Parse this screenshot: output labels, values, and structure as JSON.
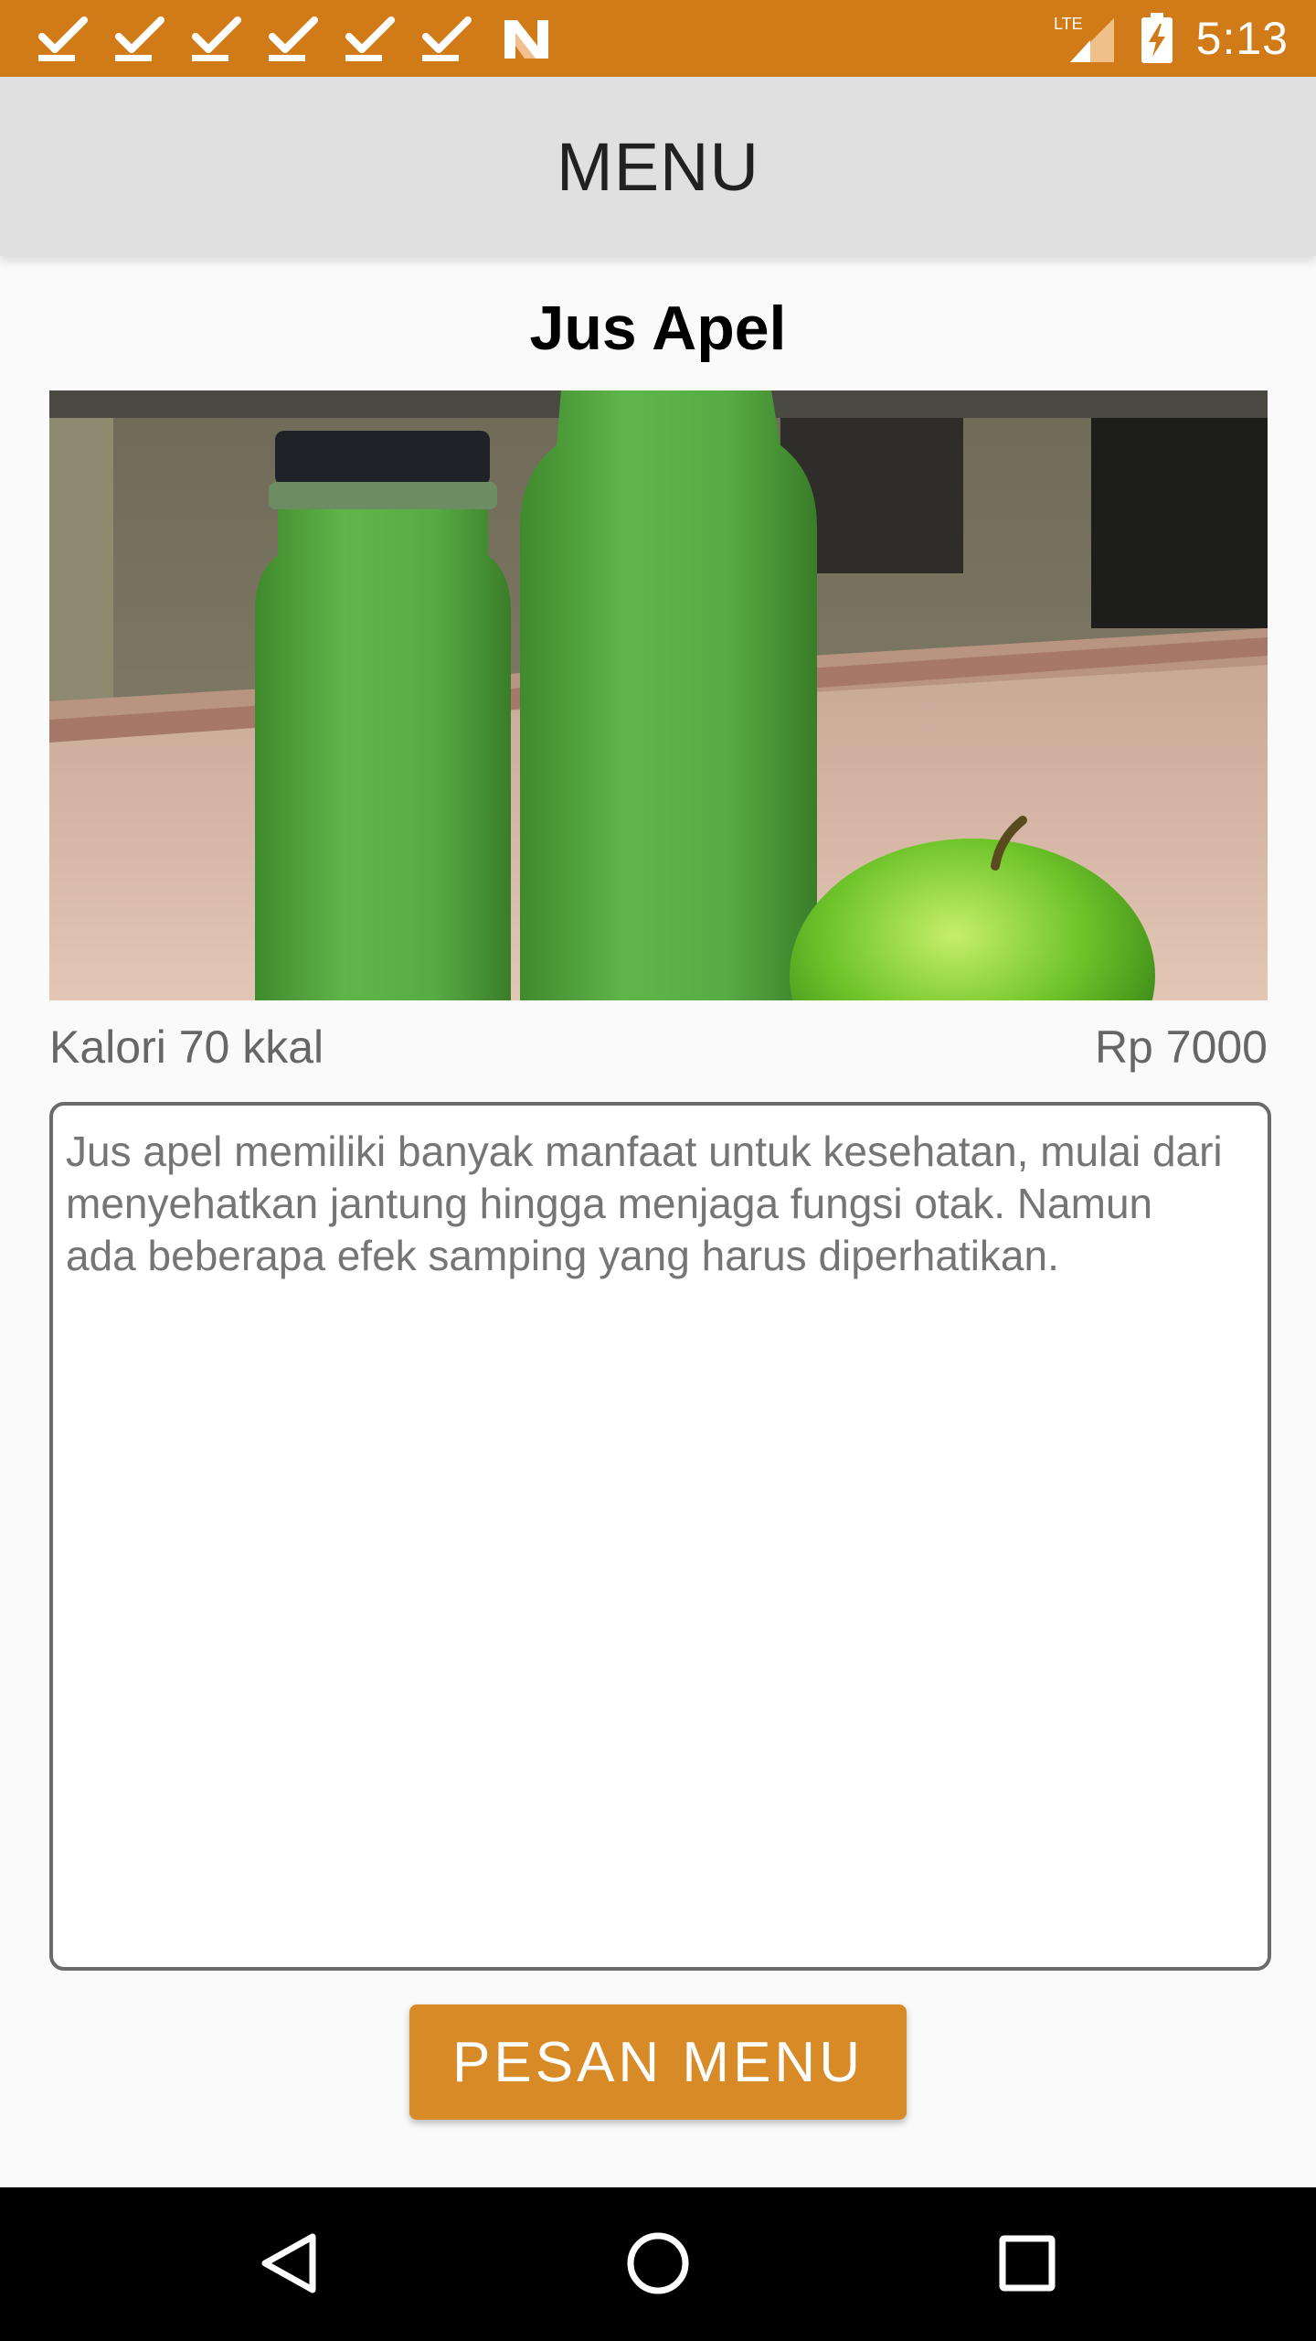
{
  "status_bar": {
    "time": "5:13",
    "network": "LTE",
    "notification_icons": [
      "check-icon",
      "check-icon",
      "check-icon",
      "check-icon",
      "check-icon",
      "check-icon",
      "n-app-icon"
    ],
    "background_color": "#d07b18"
  },
  "app_bar": {
    "title": "MENU"
  },
  "item": {
    "name": "Jus Apel",
    "calories": "Kalori 70 kkal",
    "price": "Rp 7000",
    "description": "Jus apel memiliki banyak manfaat untuk kesehatan, mulai dari menyehatkan jantung hingga menjaga fungsi otak. Namun ada beberapa efek samping yang harus diperhatikan."
  },
  "order_button": {
    "label": "PESAN MENU",
    "color": "#d88a26"
  },
  "nav_bar": {
    "icons": [
      "back-icon",
      "home-icon",
      "recents-icon"
    ]
  }
}
